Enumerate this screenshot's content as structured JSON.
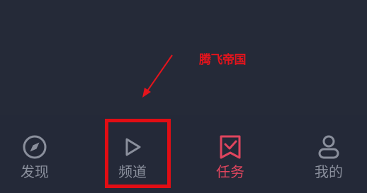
{
  "annotation": {
    "label": "腾飞帝国",
    "color": "#e4141c",
    "highlight_color": "#e10d14"
  },
  "tabbar": {
    "inactive_color": "#8a8f9c",
    "active_color": "#e0455e",
    "tabs": [
      {
        "label": "发现",
        "icon": "compass-icon",
        "active": false
      },
      {
        "label": "频道",
        "icon": "play-icon",
        "active": false
      },
      {
        "label": "任务",
        "icon": "task-bookmark-check-icon",
        "active": true
      },
      {
        "label": "我的",
        "icon": "user-profile-icon",
        "active": false
      }
    ]
  }
}
